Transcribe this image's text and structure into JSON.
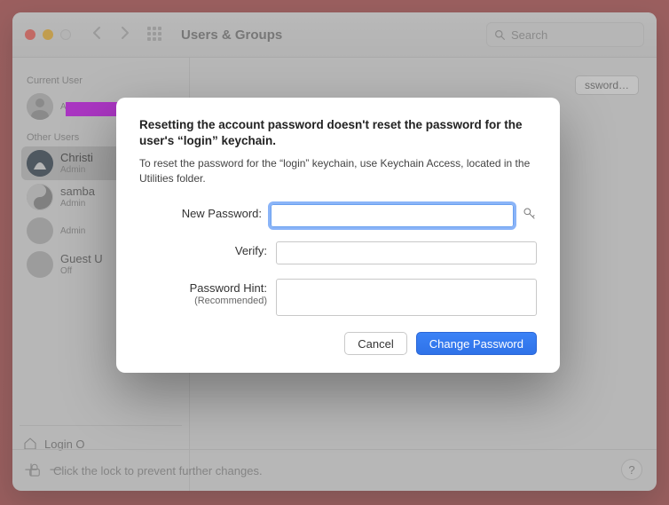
{
  "window": {
    "title": "Users & Groups",
    "search_placeholder": "Search"
  },
  "sidebar": {
    "current_label": "Current User",
    "current_user": {
      "name": "",
      "role": "Admin"
    },
    "other_label": "Other Users",
    "users": [
      {
        "name": "Christi",
        "role": "Admin"
      },
      {
        "name": "samba",
        "role": "Admin"
      },
      {
        "name": "",
        "role": "Admin"
      },
      {
        "name": "Guest U",
        "role": "Off"
      }
    ],
    "login_options": "Login O",
    "plus": "＋",
    "minus": "－"
  },
  "main": {
    "reset_button": "ssword…",
    "footer_text": "Click the lock to prevent further changes.",
    "help": "?"
  },
  "dialog": {
    "heading": "Resetting the account password doesn't reset the password for the user's “login” keychain.",
    "description": "To reset the password for the “login” keychain, use Keychain Access, located in the Utilities folder.",
    "new_password_label": "New Password:",
    "verify_label": "Verify:",
    "hint_label": "Password Hint:",
    "hint_sub": "(Recommended)",
    "new_password_value": "",
    "verify_value": "",
    "hint_value": "",
    "cancel": "Cancel",
    "change": "Change Password"
  }
}
